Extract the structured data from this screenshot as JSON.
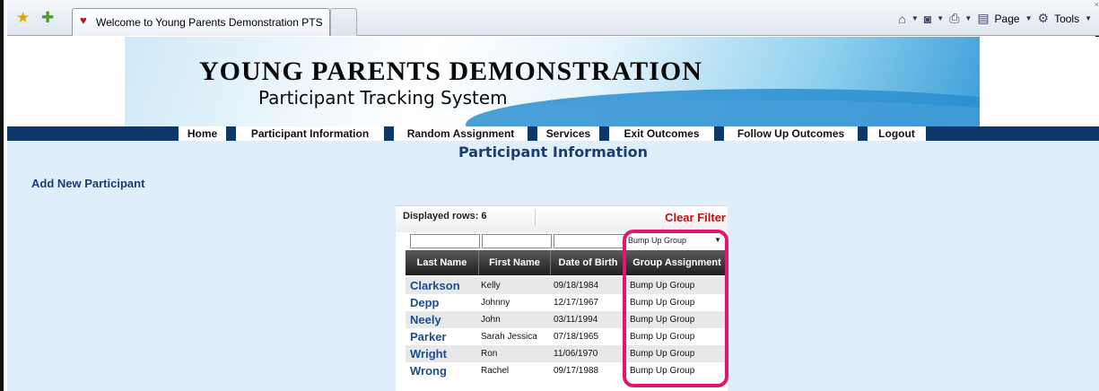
{
  "browser": {
    "tab_title": "Welcome to Young Parents Demonstration PTS",
    "page_menu": "Page",
    "tools_menu": "Tools",
    "close_glyph": "×"
  },
  "banner": {
    "title": "YOUNG PARENTS DEMONSTRATION",
    "subtitle": "Participant Tracking System"
  },
  "nav": {
    "items": [
      {
        "label": "Home"
      },
      {
        "label": "Participant Information"
      },
      {
        "label": "Random Assignment"
      },
      {
        "label": "Services"
      },
      {
        "label": "Exit Outcomes"
      },
      {
        "label": "Follow Up Outcomes"
      },
      {
        "label": "Logout"
      }
    ]
  },
  "page": {
    "title": "Participant Information",
    "add_new_label": "Add New Participant"
  },
  "grid": {
    "displayed_rows_label": "Displayed rows: 6",
    "clear_filter_label": "Clear Filter",
    "group_filter_value": "Bump Up Group",
    "columns": [
      "Last Name",
      "First Name",
      "Date of Birth",
      "Group Assignment"
    ],
    "rows": [
      {
        "last": "Clarkson",
        "first": "Kelly",
        "dob": "09/18/1984",
        "group": "Bump Up Group"
      },
      {
        "last": "Depp",
        "first": "Johnny",
        "dob": "12/17/1967",
        "group": "Bump Up Group"
      },
      {
        "last": "Neely",
        "first": "John",
        "dob": "03/11/1994",
        "group": "Bump Up Group"
      },
      {
        "last": "Parker",
        "first": "Sarah Jessica",
        "dob": "07/18/1965",
        "group": "Bump Up Group"
      },
      {
        "last": "Wright",
        "first": "Ron",
        "dob": "11/06/1970",
        "group": "Bump Up Group"
      },
      {
        "last": "Wrong",
        "first": "Rachel",
        "dob": "09/17/1988",
        "group": "Bump Up Group"
      }
    ]
  },
  "colors": {
    "nav_bar": "#0f3868",
    "page_background": "#dfeefa",
    "title_blue": "#1b3e6f",
    "clear_filter_red": "#c01010",
    "annotation_pink": "#e5146c"
  },
  "icons": {
    "favorites": "star-icon",
    "add_favorites": "add-favorites-icon",
    "tab_favicon": "heart-icon",
    "home": "home-icon",
    "feeds": "rss-icon",
    "print": "print-icon",
    "page": "page-icon",
    "tools": "gear-icon"
  }
}
